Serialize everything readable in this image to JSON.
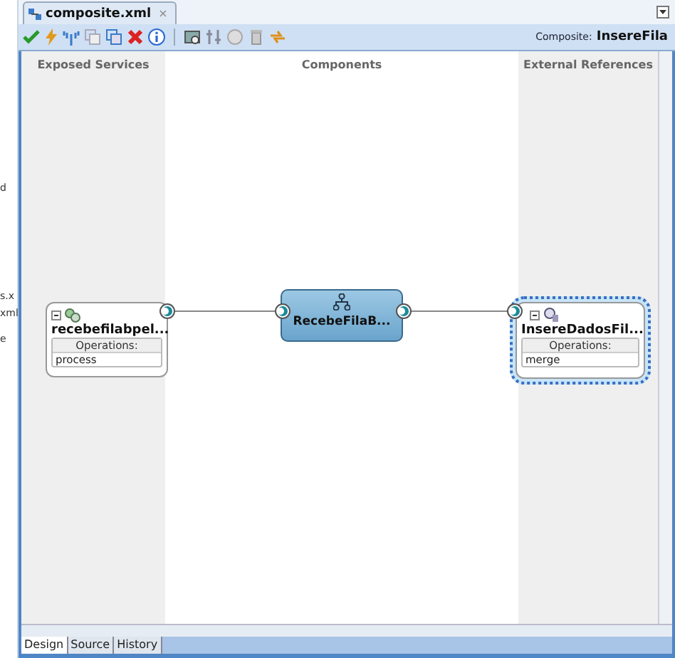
{
  "left_panel_fragments": [
    "d",
    "s.x",
    "xml",
    "e"
  ],
  "editor_tab": {
    "label": "composite.xml",
    "close": "×"
  },
  "toolbar": {
    "composite_label": "Composite:",
    "composite_name": "InsereFila"
  },
  "swimlanes": [
    {
      "title": "Exposed Services",
      "shaded": true
    },
    {
      "title": "Components",
      "shaded": false
    },
    {
      "title": "External References",
      "shaded": true
    }
  ],
  "services": [
    {
      "name": "recebefilabpel...",
      "operations_label": "Operations:",
      "operations": [
        "process"
      ],
      "selected": false
    }
  ],
  "components": [
    {
      "name": "RecebeFilaB..."
    }
  ],
  "references": [
    {
      "name": "InsereDadosFil...",
      "operations_label": "Operations:",
      "operations": [
        "merge"
      ],
      "selected": true
    }
  ],
  "bottom_tabs": [
    {
      "label": "Design",
      "selected": true
    },
    {
      "label": "Source",
      "selected": false
    },
    {
      "label": "History",
      "selected": false
    }
  ]
}
